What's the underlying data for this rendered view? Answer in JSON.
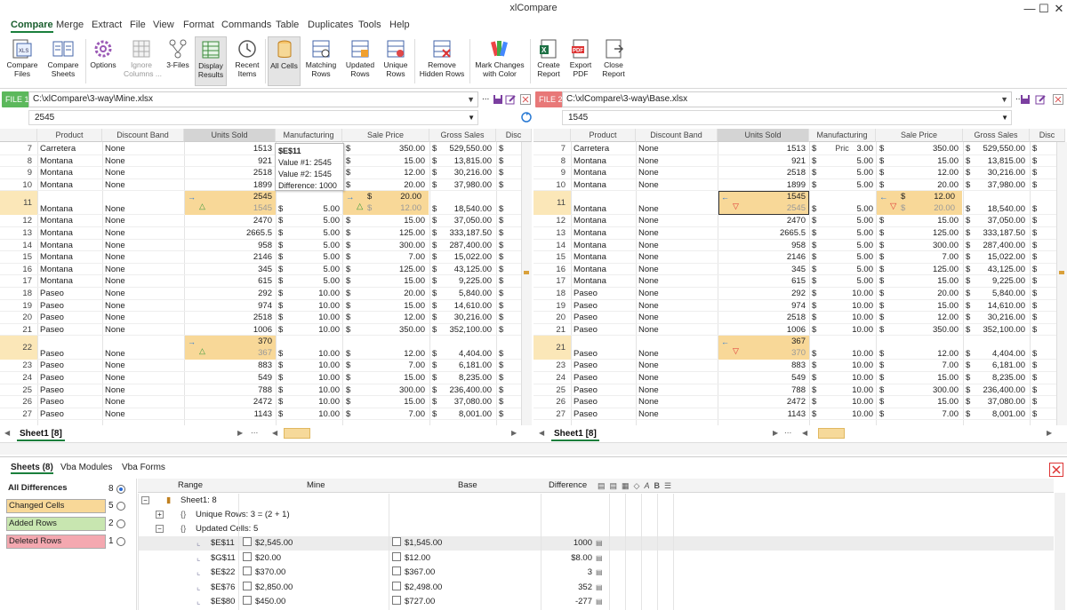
{
  "app": {
    "title": "xlCompare"
  },
  "menu": [
    "Compare",
    "Merge",
    "Extract",
    "File",
    "View",
    "Format",
    "Commands",
    "Table",
    "Duplicates",
    "Tools",
    "Help"
  ],
  "ribbon": {
    "compare_files": "Compare\nFiles",
    "compare_sheets": "Compare\nSheets",
    "options": "Options",
    "ignore_columns": "Ignore\nColumns ...",
    "three_files": "3-Files",
    "display_results": "Display\nResults",
    "recent_items": "Recent\nItems",
    "all_cells": "All Cells",
    "matching_rows": "Matching\nRows",
    "updated_rows": "Updated\nRows",
    "unique_rows": "Unique\nRows",
    "remove_hidden_rows": "Remove\nHidden Rows",
    "mark_changes": "Mark Changes\nwith Color",
    "create_report": "Create\nReport",
    "export_pdf": "Export\nPDF",
    "close_report": "Close\nReport"
  },
  "left": {
    "file_tag": "FILE 1",
    "path": "C:\\xlCompare\\3-way\\Mine.xlsx",
    "cell_value": "2545",
    "sheet_tab": "Sheet1 [8]",
    "rows": [
      [
        "7",
        "Carretera",
        "None",
        "1513",
        "$",
        "350.00",
        "$",
        "529,550.00",
        "$"
      ],
      [
        "8",
        "Montana",
        "None",
        "921",
        "$",
        "15.00",
        "$",
        "13,815.00",
        "$"
      ],
      [
        "9",
        "Montana",
        "None",
        "2518",
        "$",
        "12.00",
        "$",
        "30,216.00",
        "$"
      ],
      [
        "10",
        "Montana",
        "None",
        "1899",
        "$",
        "20.00",
        "$",
        "37,980.00",
        "$"
      ],
      [
        "12",
        "Montana",
        "None",
        "2470",
        "$",
        "15.00",
        "$",
        "37,050.00",
        "$"
      ],
      [
        "13",
        "Montana",
        "None",
        "2665.5",
        "$",
        "125.00",
        "$",
        "333,187.50",
        "$"
      ],
      [
        "14",
        "Montana",
        "None",
        "958",
        "$",
        "300.00",
        "$",
        "287,400.00",
        "$"
      ],
      [
        "15",
        "Montana",
        "None",
        "2146",
        "$",
        "7.00",
        "$",
        "15,022.00",
        "$"
      ],
      [
        "16",
        "Montana",
        "None",
        "345",
        "$",
        "125.00",
        "$",
        "43,125.00",
        "$"
      ],
      [
        "17",
        "Montana",
        "None",
        "615",
        "$",
        "15.00",
        "$",
        "9,225.00",
        "$"
      ],
      [
        "18",
        "Paseo",
        "None",
        "292",
        "$",
        "20.00",
        "$",
        "5,840.00",
        "$"
      ],
      [
        "19",
        "Paseo",
        "None",
        "974",
        "$",
        "15.00",
        "$",
        "14,610.00",
        "$"
      ],
      [
        "20",
        "Paseo",
        "None",
        "2518",
        "$",
        "12.00",
        "$",
        "30,216.00",
        "$"
      ],
      [
        "21",
        "Paseo",
        "None",
        "1006",
        "$",
        "350.00",
        "$",
        "352,100.00",
        "$"
      ],
      [
        "23",
        "Paseo",
        "None",
        "883",
        "$",
        "7.00",
        "$",
        "6,181.00",
        "$"
      ],
      [
        "24",
        "Paseo",
        "None",
        "549",
        "$",
        "15.00",
        "$",
        "8,235.00",
        "$"
      ],
      [
        "25",
        "Paseo",
        "None",
        "788",
        "$",
        "300.00",
        "$",
        "236,400.00",
        "$"
      ],
      [
        "26",
        "Paseo",
        "None",
        "2472",
        "$",
        "15.00",
        "$",
        "37,080.00",
        "$"
      ],
      [
        "27",
        "Paseo",
        "None",
        "1143",
        "$",
        "7.00",
        "$",
        "8,001.00",
        "$"
      ]
    ],
    "mfg": [
      "",
      "",
      "",
      "",
      "5.00",
      "5.00",
      "5.00",
      "5.00",
      "5.00",
      "5.00",
      "10.00",
      "10.00",
      "10.00",
      "10.00",
      "10.00",
      "10.00",
      "10.00",
      "10.00",
      "10.00"
    ],
    "r11": {
      "num": "11",
      "product": "Montana",
      "band": "None",
      "new": "2545",
      "old": "1545",
      "mfg": "5.00",
      "sale_new": "20.00",
      "sale_old": "12.00",
      "gross": "18,540.00"
    },
    "r22": {
      "num": "22",
      "product": "Paseo",
      "band": "None",
      "new": "370",
      "old": "367",
      "mfg": "10.00",
      "sale": "12.00",
      "gross": "4,404.00"
    }
  },
  "right": {
    "file_tag": "FILE 2",
    "path": "C:\\xlCompare\\3-way\\Base.xlsx",
    "cell_value": "1545",
    "sheet_tab": "Sheet1 [8]",
    "mfg": [
      "3.00",
      "5.00",
      "5.00",
      "5.00",
      "5.00",
      "5.00",
      "5.00",
      "5.00",
      "5.00",
      "5.00",
      "10.00",
      "10.00",
      "10.00",
      "10.00",
      "10.00",
      "10.00",
      "10.00",
      "10.00",
      "10.00"
    ],
    "units": [
      "1513",
      "921",
      "2518",
      "1899",
      "2470",
      "2665.5",
      "958",
      "2146",
      "345",
      "615",
      "292",
      "974",
      "2518",
      "1006",
      "883",
      "549",
      "788",
      "2472",
      "1143"
    ],
    "r11": {
      "num": "11",
      "product": "Montana",
      "band": "None",
      "new": "1545",
      "old": "2545",
      "mfg": "5.00",
      "sale_new": "12.00",
      "sale_old": "20.00",
      "gross": "18,540.00"
    },
    "r22": {
      "num": "21",
      "product": "Paseo",
      "band": "None",
      "new": "367",
      "old": "370",
      "mfg": "10.00",
      "sale": "12.00",
      "gross": "4,404.00"
    }
  },
  "headers": [
    "Product",
    "Discount Band",
    "Units Sold",
    "Manufacturing Pric",
    "Sale Price",
    "Gross Sales",
    "Disc"
  ],
  "tooltip": {
    "cell": "$E$11",
    "v1": "Value #1: 2545",
    "v2": "Value #2: 1545",
    "diff": "Difference: 1000"
  },
  "bottom": {
    "tabs": [
      "Sheets (8)",
      "Vba Modules",
      "Vba Forms"
    ],
    "legend": [
      {
        "label": "All Differences",
        "count": "8",
        "color": "#ffffff"
      },
      {
        "label": "Changed Cells",
        "count": "5",
        "color": "#f8d898"
      },
      {
        "label": "Added Rows",
        "count": "2",
        "color": "#c8e6b0"
      },
      {
        "label": "Deleted Rows",
        "count": "1",
        "color": "#f4a8b0"
      }
    ],
    "cols": [
      "Range",
      "Mine",
      "Base",
      "Difference"
    ],
    "sheet": "Sheet1: 8",
    "unique": "Unique Rows: 3 = (2 + 1)",
    "updated": "Updated Cells: 5",
    "diffs": [
      {
        "range": "$E$11",
        "mine": "$2,545.00",
        "base": "$1,545.00",
        "diff": "1000"
      },
      {
        "range": "$G$11",
        "mine": "$20.00",
        "base": "$12.00",
        "diff": "$8.00"
      },
      {
        "range": "$E$22",
        "mine": "$370.00",
        "base": "$367.00",
        "diff": "3"
      },
      {
        "range": "$E$76",
        "mine": "$2,850.00",
        "base": "$2,498.00",
        "diff": "352"
      },
      {
        "range": "$E$80",
        "mine": "$450.00",
        "base": "$727.00",
        "diff": "-277"
      }
    ]
  },
  "colors": {
    "accent": "#1a7f3c",
    "changed": "#f8d898",
    "file1": "#5cb85c",
    "file2": "#e87878"
  }
}
